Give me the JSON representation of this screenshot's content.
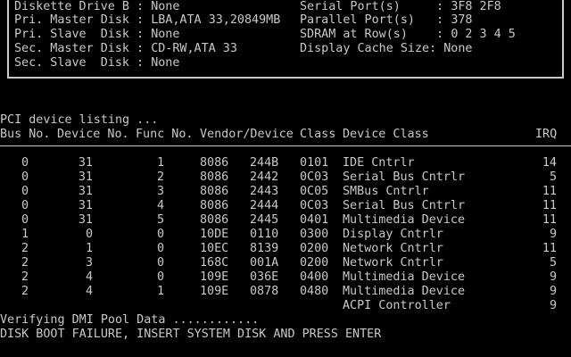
{
  "system_box": {
    "left": [
      {
        "label": "Diskette Drive B",
        "value": "None"
      },
      {
        "label": "Pri. Master Disk",
        "value": "LBA,ATA 33,20849MB"
      },
      {
        "label": "Pri. Slave  Disk",
        "value": "None"
      },
      {
        "label": "Sec. Master Disk",
        "value": "CD-RW,ATA 33"
      },
      {
        "label": "Sec. Slave  Disk",
        "value": "None"
      }
    ],
    "right": [
      {
        "label": "Serial Port(s)    ",
        "value": "3F8 2F8"
      },
      {
        "label": "Parallel Port(s)  ",
        "value": "378"
      },
      {
        "label": "SDRAM at Row(s)   ",
        "value": "0 2 3 4 5"
      },
      {
        "label": "Display Cache Size",
        "value": "None"
      }
    ]
  },
  "pci": {
    "title": "PCI device listing ...",
    "headers": {
      "bus": "Bus No.",
      "device": "Device No.",
      "func": "Func No.",
      "vendor_device": "Vendor/Device",
      "class": "Class",
      "device_class": "Device Class",
      "irq": "IRQ"
    },
    "rows": [
      {
        "bus": "0",
        "device": "31",
        "func": "1",
        "vendor": "8086",
        "devid": "244B",
        "class": "0101",
        "desc": "IDE Cntrlr",
        "irq": "14"
      },
      {
        "bus": "0",
        "device": "31",
        "func": "2",
        "vendor": "8086",
        "devid": "2442",
        "class": "0C03",
        "desc": "Serial Bus Cntrlr",
        "irq": "5"
      },
      {
        "bus": "0",
        "device": "31",
        "func": "3",
        "vendor": "8086",
        "devid": "2443",
        "class": "0C05",
        "desc": "SMBus Cntrlr",
        "irq": "11"
      },
      {
        "bus": "0",
        "device": "31",
        "func": "4",
        "vendor": "8086",
        "devid": "2444",
        "class": "0C03",
        "desc": "Serial Bus Cntrlr",
        "irq": "11"
      },
      {
        "bus": "0",
        "device": "31",
        "func": "5",
        "vendor": "8086",
        "devid": "2445",
        "class": "0401",
        "desc": "Multimedia Device",
        "irq": "11"
      },
      {
        "bus": "1",
        "device": "0",
        "func": "0",
        "vendor": "10DE",
        "devid": "0110",
        "class": "0300",
        "desc": "Display Cntrlr",
        "irq": "9"
      },
      {
        "bus": "2",
        "device": "1",
        "func": "0",
        "vendor": "10EC",
        "devid": "8139",
        "class": "0200",
        "desc": "Network Cntrlr",
        "irq": "11"
      },
      {
        "bus": "2",
        "device": "3",
        "func": "0",
        "vendor": "168C",
        "devid": "001A",
        "class": "0200",
        "desc": "Network Cntrlr",
        "irq": "5"
      },
      {
        "bus": "2",
        "device": "4",
        "func": "0",
        "vendor": "109E",
        "devid": "036E",
        "class": "0400",
        "desc": "Multimedia Device",
        "irq": "9"
      },
      {
        "bus": "2",
        "device": "4",
        "func": "1",
        "vendor": "109E",
        "devid": "0878",
        "class": "0480",
        "desc": "Multimedia Device",
        "irq": "9"
      },
      {
        "bus": "",
        "device": "",
        "func": "",
        "vendor": "",
        "devid": "",
        "class": "",
        "desc": "ACPI Controller",
        "irq": "9"
      }
    ]
  },
  "messages": {
    "dmi": "Verifying DMI Pool Data ............",
    "boot_failure": "DISK BOOT FAILURE, INSERT SYSTEM DISK AND PRESS ENTER"
  },
  "colors": {
    "background": "#000000",
    "text": "#c8c8c8"
  }
}
